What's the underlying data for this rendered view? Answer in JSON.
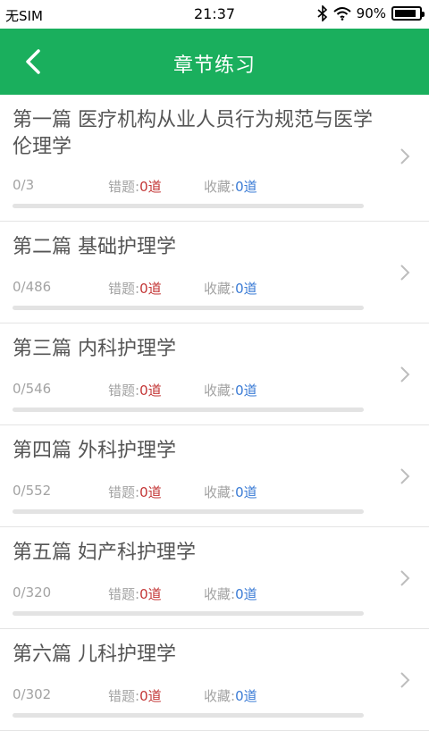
{
  "status_bar": {
    "carrier": "无SIM",
    "time": "21:37",
    "battery": "90%",
    "battery_level": 0.9,
    "icons": [
      "bluetooth-icon",
      "wifi-icon",
      "battery-icon"
    ]
  },
  "header": {
    "title": "章节练习",
    "back_icon": "chevron-left-icon",
    "color": "#1aaf5d"
  },
  "labels": {
    "wrong_label": "错题:",
    "fav_label": "收藏:"
  },
  "chapters": [
    {
      "title": "第一篇 医疗机构从业人员行为规范与医学伦理学",
      "progress": "0/3",
      "wrong": "0道",
      "favorites": "0道",
      "done_fraction": 0
    },
    {
      "title": "第二篇 基础护理学",
      "progress": "0/486",
      "wrong": "0道",
      "favorites": "0道",
      "done_fraction": 0
    },
    {
      "title": "第三篇 内科护理学",
      "progress": "0/546",
      "wrong": "0道",
      "favorites": "0道",
      "done_fraction": 0
    },
    {
      "title": "第四篇 外科护理学",
      "progress": "0/552",
      "wrong": "0道",
      "favorites": "0道",
      "done_fraction": 0
    },
    {
      "title": "第五篇 妇产科护理学",
      "progress": "0/320",
      "wrong": "0道",
      "favorites": "0道",
      "done_fraction": 0
    },
    {
      "title": "第六篇 儿科护理学",
      "progress": "0/302",
      "wrong": "0道",
      "favorites": "0道",
      "done_fraction": 0
    }
  ]
}
